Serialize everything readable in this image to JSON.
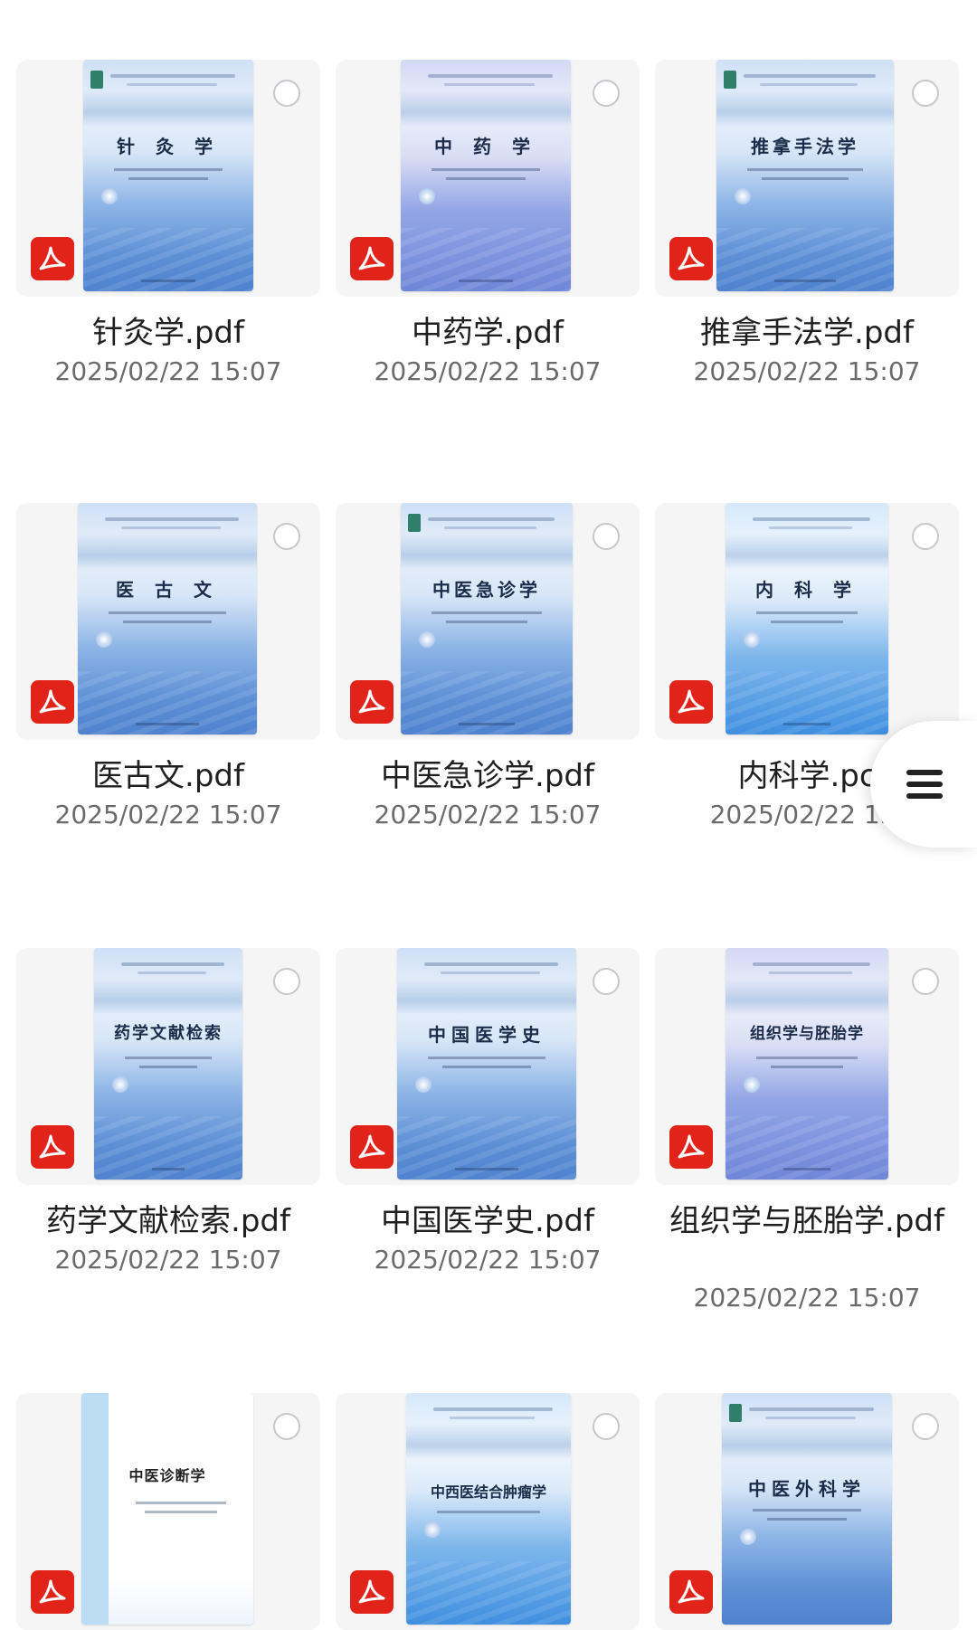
{
  "files": [
    {
      "name": "针灸学.pdf",
      "date": "2025/02/22 15:07",
      "cover_title": "针 灸 学"
    },
    {
      "name": "中药学.pdf",
      "date": "2025/02/22 15:07",
      "cover_title": "中 药 学"
    },
    {
      "name": "推拿手法学.pdf",
      "date": "2025/02/22 15:07",
      "cover_title": "推拿手法学"
    },
    {
      "name": "医古文.pdf",
      "date": "2025/02/22 15:07",
      "cover_title": "医 古 文"
    },
    {
      "name": "中医急诊学.pdf",
      "date": "2025/02/22 15:07",
      "cover_title": "中医急诊学"
    },
    {
      "name": "内科学.pc",
      "date": "2025/02/22 15.",
      "cover_title": "内 科 学"
    },
    {
      "name": "药学文献检索.pdf",
      "date": "2025/02/22 15:07",
      "cover_title": "药学文献检索"
    },
    {
      "name": "中国医学史.pdf",
      "date": "2025/02/22 15:07",
      "cover_title": "中国医学史"
    },
    {
      "name": "组织学与胚胎学.pdf",
      "date": "2025/02/22 15:07",
      "cover_title": "组织学与胚胎学"
    },
    {
      "name": "",
      "date": "",
      "cover_title": "中医诊断学"
    },
    {
      "name": "",
      "date": "",
      "cover_title": "中西医结合肿瘤学"
    },
    {
      "name": "",
      "date": "",
      "cover_title": "中医外科学"
    }
  ],
  "icons": {
    "file_type": "pdf-icon",
    "select": "radio-circle-icon",
    "menu": "hamburger-menu-icon"
  },
  "colors": {
    "pdf_badge": "#e2231a",
    "filename": "#1f1f1f",
    "date": "#6b6b6b"
  }
}
